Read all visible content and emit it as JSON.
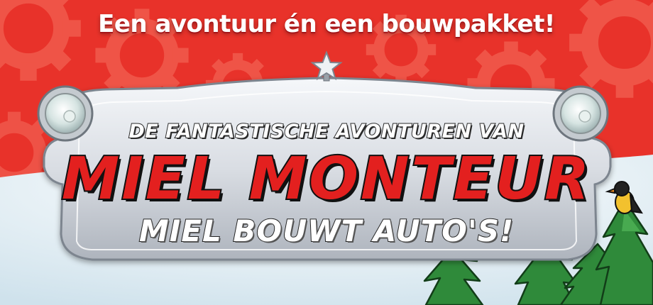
{
  "banner": {
    "tagline": "Een avontuur én een bouwpakket!",
    "logo": {
      "overline": "DE FANTASTISCHE AVONTUREN VAN",
      "title": "MIEL MONTEUR",
      "subtitle": "MIEL BOUWT AUTO'S!"
    }
  },
  "colors": {
    "background_red": "#e8322a",
    "gear_red": "#f0584b",
    "title_red": "#e3201f",
    "plate_silver": "#d9dde3",
    "tree_green": "#2f8a3a",
    "sky_pale": "#e8f2f7"
  },
  "icons": {
    "star": "star-icon",
    "left_headlight": "headlight-icon",
    "right_headlight": "headlight-icon",
    "gears": "gear-icon",
    "bird": "bird-icon"
  }
}
